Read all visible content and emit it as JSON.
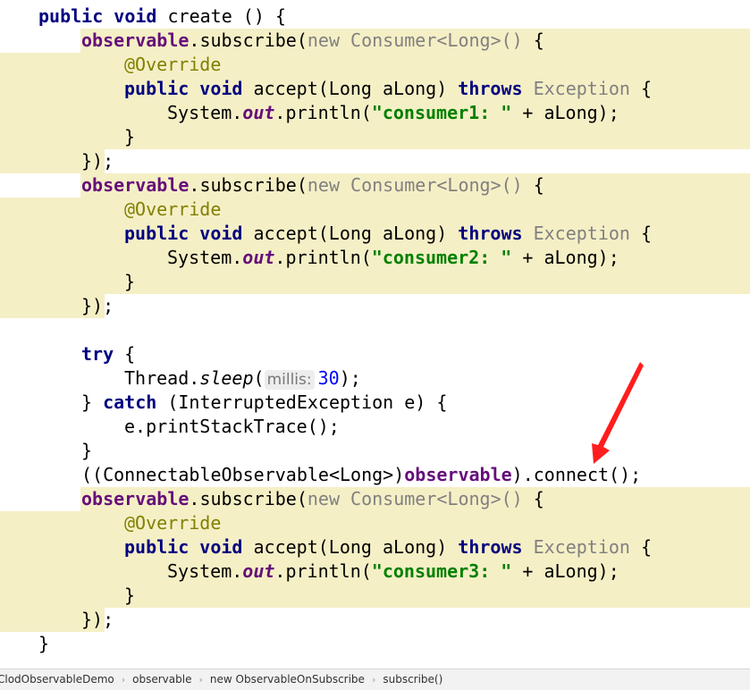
{
  "code": {
    "create_sig": {
      "kw1": "public",
      "kw2": "void",
      "name": " create () {"
    },
    "subscribe": {
      "obj": "observable",
      "call": ".subscribe(",
      "new_kw": "new",
      "type": " Consumer<Long>()",
      "open": " {"
    },
    "override": "@Override",
    "accept": {
      "kw1": "public",
      "kw2": "void",
      "sig": " accept(Long aLong) ",
      "throws_kw": "throws",
      "exc": " Exception",
      "open": " {"
    },
    "println": {
      "prefix": "System.",
      "out": "out",
      "call": ".println(",
      "plus": " + aLong);"
    },
    "consumer_strings": [
      "\"consumer1: \"",
      "\"consumer2: \"",
      "\"consumer3: \""
    ],
    "close_brace": "}",
    "close_call": "});",
    "try_kw": "try",
    "open_brace_sp": " {",
    "thread_sleep": {
      "prefix": "Thread.",
      "method": "sleep",
      "paren": "(",
      "hint_label": "millis:",
      "value": "30",
      "end": ");"
    },
    "catch": {
      "close": "} ",
      "kw": "catch",
      "rest": " (InterruptedException e) {"
    },
    "print_stack": "e.printStackTrace();",
    "connect": {
      "prefix": "((ConnectableObservable<Long>)",
      "obj": "observable",
      "suffix": ").connect();"
    }
  },
  "breadcrumb": {
    "items": [
      "ClodObservableDemo",
      "observable",
      "new ObservableOnSubscribe",
      "subscribe()"
    ],
    "separator": "›"
  },
  "colors": {
    "keyword": "#000080",
    "field": "#660e7a",
    "string": "#008000",
    "annotation": "#808000",
    "number": "#0000ff",
    "highlight": "#f5efc6",
    "arrow": "#ff1d1d"
  }
}
